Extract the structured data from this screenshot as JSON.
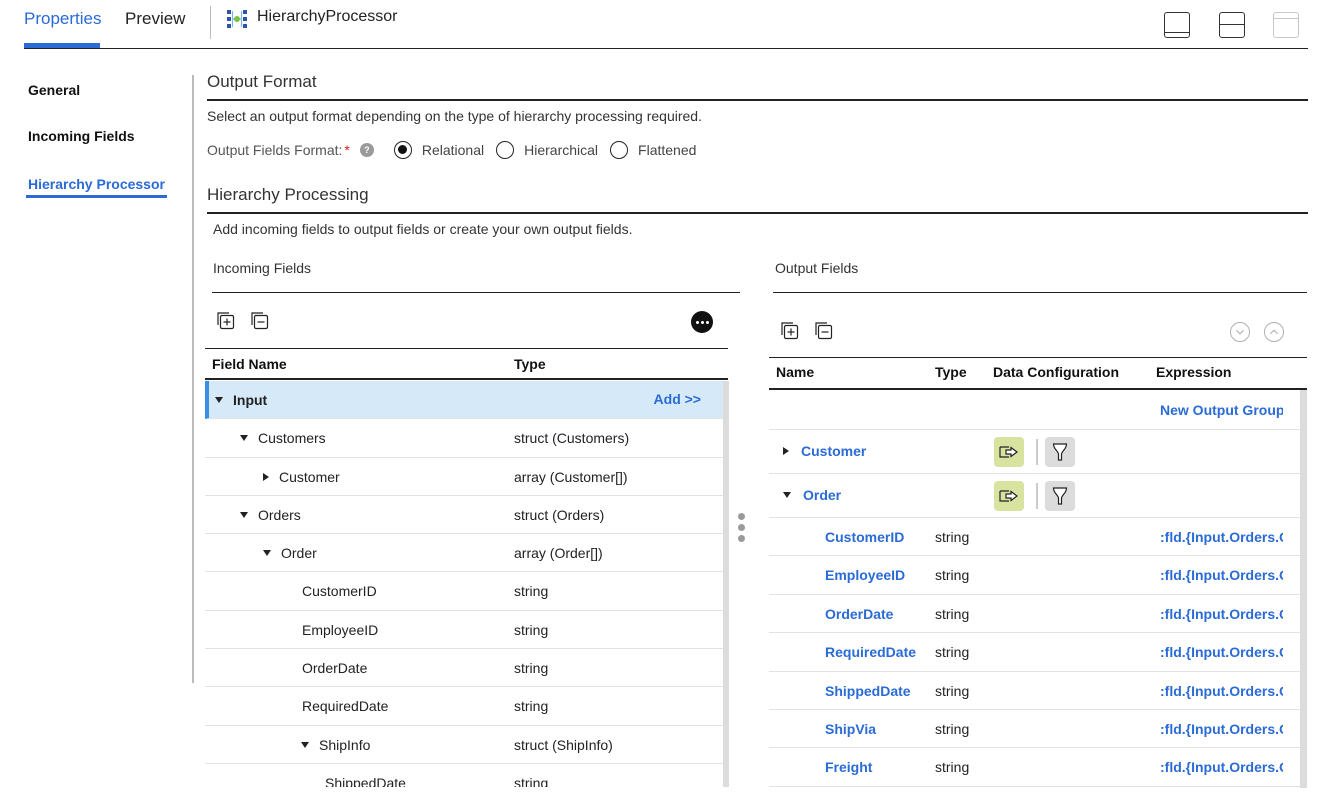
{
  "header": {
    "tabs": [
      {
        "label": "Properties",
        "active": true
      },
      {
        "label": "Preview",
        "active": false
      }
    ],
    "transformation_name": "HierarchyProcessor",
    "layout_buttons": [
      "dock-bottom-icon",
      "split-horizontal-icon",
      "maximize-panel-icon"
    ]
  },
  "sidebar": {
    "items": [
      {
        "label": "General",
        "active": false
      },
      {
        "label": "Incoming Fields",
        "active": false
      },
      {
        "label": "Hierarchy Processor",
        "active": true
      }
    ]
  },
  "output_format": {
    "title": "Output Format",
    "description": "Select an output format depending on the type of hierarchy processing required.",
    "field_label": "Output Fields Format:",
    "required_mark": "*",
    "help_icon": "?",
    "options": [
      {
        "label": "Relational",
        "selected": true
      },
      {
        "label": "Hierarchical",
        "selected": false
      },
      {
        "label": "Flattened",
        "selected": false
      }
    ]
  },
  "hierarchy_processing": {
    "title": "Hierarchy Processing",
    "description": "Add incoming fields to output fields or create your own output fields."
  },
  "incoming": {
    "title": "Incoming Fields",
    "columns": [
      "Field Name",
      "Type"
    ],
    "add_label": "Add >>",
    "rows": [
      {
        "name": "Input",
        "type": "",
        "level": 0,
        "expander": "down",
        "selected": true
      },
      {
        "name": "Customers",
        "type": "struct (Customers)",
        "level": 1,
        "expander": "down"
      },
      {
        "name": "Customer",
        "type": "array (Customer[])",
        "level": 2,
        "expander": "right"
      },
      {
        "name": "Orders",
        "type": "struct (Orders)",
        "level": 1,
        "expander": "down"
      },
      {
        "name": "Order",
        "type": "array (Order[])",
        "level": 2,
        "expander": "down"
      },
      {
        "name": "CustomerID",
        "type": "string",
        "level": 3,
        "expander": ""
      },
      {
        "name": "EmployeeID",
        "type": "string",
        "level": 3,
        "expander": ""
      },
      {
        "name": "OrderDate",
        "type": "string",
        "level": 3,
        "expander": ""
      },
      {
        "name": "RequiredDate",
        "type": "string",
        "level": 3,
        "expander": ""
      },
      {
        "name": "ShipInfo",
        "type": "struct (ShipInfo)",
        "level": 3,
        "expander": "down"
      },
      {
        "name": "ShippedDate",
        "type": "string",
        "level": 4,
        "expander": ""
      }
    ]
  },
  "output": {
    "title": "Output Fields",
    "columns": [
      "Name",
      "Type",
      "Data Configuration",
      "Expression"
    ],
    "new_group_label": "New Output Group",
    "groups": [
      {
        "name": "Customer",
        "expander": "right"
      },
      {
        "name": "Order",
        "expander": "down"
      }
    ],
    "fields": [
      {
        "name": "CustomerID",
        "type": "string",
        "expression": ":fld.{Input.Orders.Order.CustomerID}"
      },
      {
        "name": "EmployeeID",
        "type": "string",
        "expression": ":fld.{Input.Orders.Order.EmployeeID}"
      },
      {
        "name": "OrderDate",
        "type": "string",
        "expression": ":fld.{Input.Orders.Order.OrderDate}"
      },
      {
        "name": "RequiredDate",
        "type": "string",
        "expression": ":fld.{Input.Orders.Order.RequiredDate}"
      },
      {
        "name": "ShippedDate",
        "type": "string",
        "expression": ":fld.{Input.Orders.Order.ShipInfo.ShippedDate}"
      },
      {
        "name": "ShipVia",
        "type": "string",
        "expression": ":fld.{Input.Orders.Order.ShipInfo.ShipVia}"
      },
      {
        "name": "Freight",
        "type": "string",
        "expression": ":fld.{Input.Orders.Order.ShipInfo.Freight}"
      }
    ]
  },
  "colors": {
    "accent": "#2a6bd6",
    "selected_row": "#d6e9f9",
    "map_button": "#d9e3a0",
    "filter_button": "#dcdcdc",
    "required": "#d02020"
  }
}
